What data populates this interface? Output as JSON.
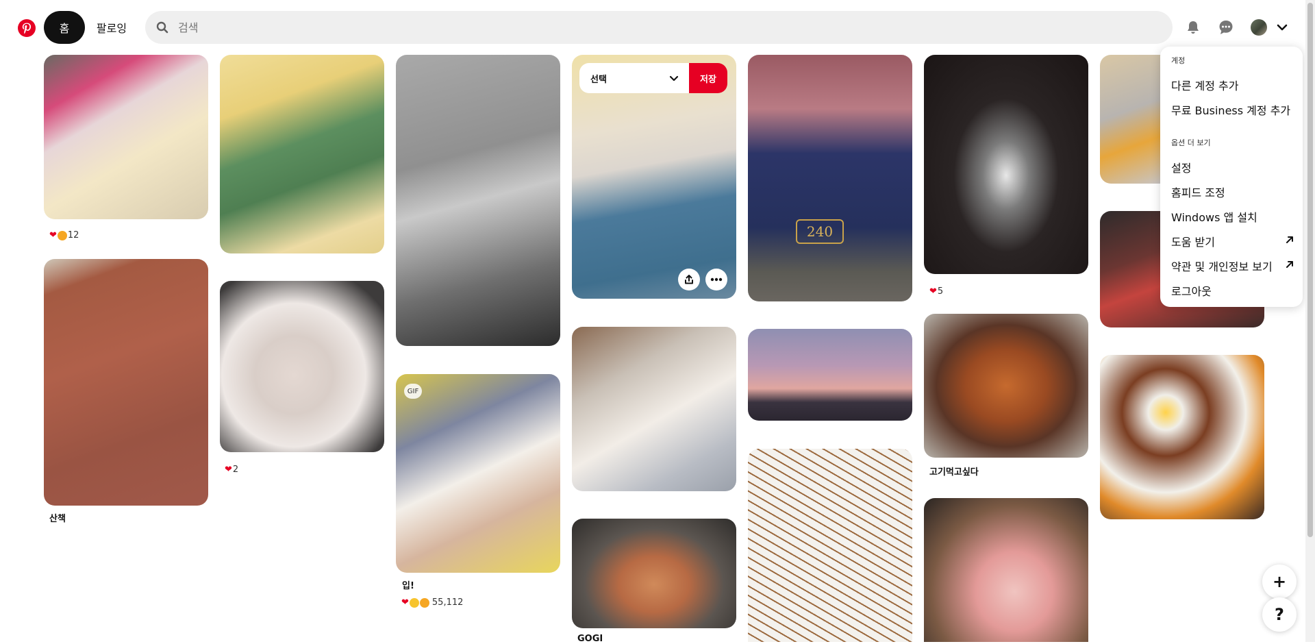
{
  "header": {
    "home_label": "홈",
    "following_label": "팔로잉",
    "search_placeholder": "검색",
    "accent": "#e60023"
  },
  "pins": [
    {
      "id": "p1",
      "icon": "dog-sleeping-photo",
      "reactions_count": "12"
    },
    {
      "id": "p2",
      "icon": "dog-sweater-photo"
    },
    {
      "id": "p3",
      "icon": "dog-walk-night-photo"
    },
    {
      "id": "p4",
      "icon": "dog-bed-photo"
    },
    {
      "id": "p5",
      "icon": "tram-240-photo",
      "sign": "240"
    },
    {
      "id": "p6",
      "icon": "cat-photo",
      "reactions_count": "5"
    },
    {
      "id": "p7",
      "icon": "food-foil-photo"
    },
    {
      "id": "p8",
      "icon": "dog-walk-photo",
      "caption": "산책"
    },
    {
      "id": "p9",
      "icon": "dog-closeup-photo",
      "reactions_count": "2"
    },
    {
      "id": "p10",
      "icon": "dog-gif-photo",
      "gif_label": "GIF",
      "caption": "입!",
      "reactions_count": "55,112"
    },
    {
      "id": "p11",
      "icon": "dog-lying-photo"
    },
    {
      "id": "p12",
      "icon": "dusk-building-photo"
    },
    {
      "id": "p13",
      "icon": "grilled-meat-photo",
      "caption": "고기먹고싶다"
    },
    {
      "id": "p14",
      "icon": "bacon-grill-photo"
    },
    {
      "id": "p15",
      "icon": "burger-plate-photo"
    },
    {
      "id": "p16",
      "icon": "grilled-chicken-photo",
      "caption": "GOGI"
    },
    {
      "id": "p17",
      "icon": "printed-bag-photo"
    },
    {
      "id": "p18",
      "icon": "pork-belly-photo"
    }
  ],
  "pin_overlay": {
    "board_select_label": "선택",
    "save_label": "저장"
  },
  "menu": {
    "account_section": "계정",
    "add_account": "다른 계정 추가",
    "add_business": "무료 Business 계정 추가",
    "more_section": "옵션 더 보기",
    "settings": "설정",
    "tune_home": "홈피드 조정",
    "install_windows": "Windows 앱 설치",
    "get_help": "도움 받기",
    "terms_privacy": "약관 및 개인정보 보기",
    "logout": "로그아웃"
  },
  "fab": {
    "plus": "+",
    "help": "?"
  }
}
